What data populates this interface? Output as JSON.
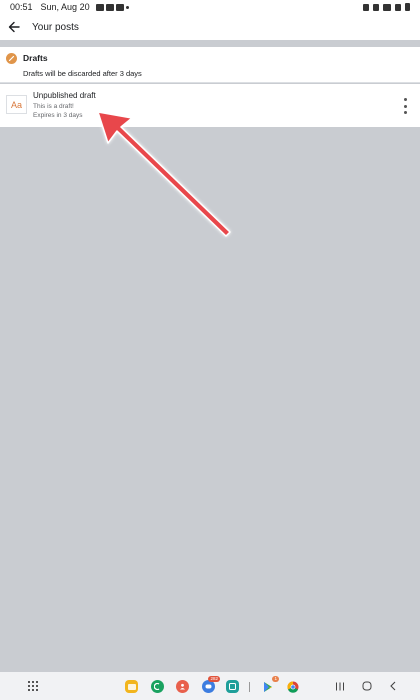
{
  "status_bar": {
    "time": "00:51",
    "date": "Sun, Aug 20"
  },
  "header": {
    "title": "Your posts",
    "back_icon": "arrow-left-icon"
  },
  "drafts": {
    "title": "Drafts",
    "subtitle": "Drafts will be discarded after 3 days",
    "icon": "pencil-icon",
    "icon_color": "#e0954a"
  },
  "draft_items": [
    {
      "thumb": "Aa",
      "title": "Unpublished draft",
      "preview": "This is a draft!",
      "expiry": "Expires in 3 days"
    }
  ],
  "annotation": {
    "arrow_color": "#e8474c"
  },
  "nav": {
    "dock_apps": [
      {
        "name": "files-app-icon",
        "color": "#f2b51d"
      },
      {
        "name": "phone-app-icon",
        "color": "#1aa260"
      },
      {
        "name": "contacts-app-icon",
        "color": "#e8604c"
      },
      {
        "name": "messages-app-icon",
        "color": "#3d7de0",
        "badge": "282"
      },
      {
        "name": "calendar-app-icon",
        "color": "#1f9f9a"
      },
      {
        "name": "play-store-app-icon",
        "color": "#ffffff",
        "badge": "1"
      },
      {
        "name": "chrome-app-icon",
        "color": "#ffffff"
      }
    ]
  }
}
